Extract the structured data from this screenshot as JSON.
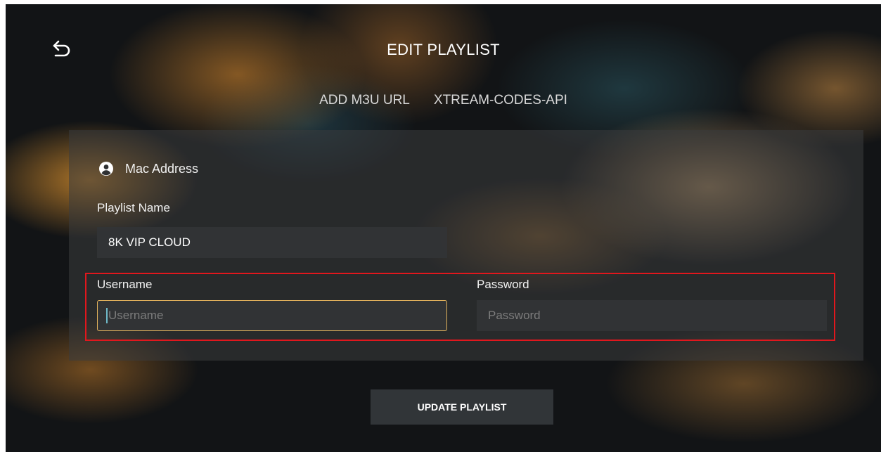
{
  "header": {
    "title": "EDIT PLAYLIST",
    "back_icon": "back-arrow-icon"
  },
  "tabs": [
    {
      "label": "ADD M3U URL"
    },
    {
      "label": "XTREAM-CODES-API"
    }
  ],
  "form": {
    "mac_label": "Mac Address",
    "mac_icon": "user-circle-icon",
    "playlist_name_label": "Playlist Name",
    "playlist_name_value": "8K VIP CLOUD",
    "username_label": "Username",
    "username_placeholder": "Username",
    "password_label": "Password",
    "password_placeholder": "Password"
  },
  "actions": {
    "update_label": "UPDATE PLAYLIST"
  },
  "colors": {
    "focus_border": "#e2b25c",
    "highlight_border": "#e1171d",
    "background": "#121416"
  }
}
